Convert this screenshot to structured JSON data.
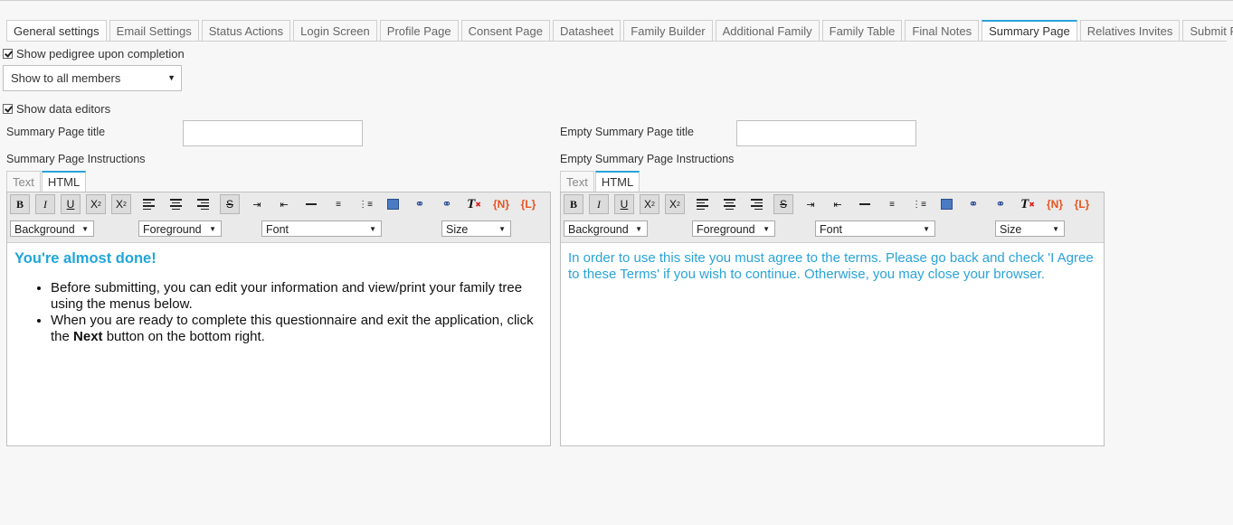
{
  "tabs": [
    {
      "label": "General settings"
    },
    {
      "label": "Email Settings"
    },
    {
      "label": "Status Actions"
    },
    {
      "label": "Login Screen"
    },
    {
      "label": "Profile Page"
    },
    {
      "label": "Consent Page"
    },
    {
      "label": "Datasheet"
    },
    {
      "label": "Family Builder"
    },
    {
      "label": "Additional Family"
    },
    {
      "label": "Family Table"
    },
    {
      "label": "Final Notes"
    },
    {
      "label": "Summary Page"
    },
    {
      "label": "Relatives Invites"
    },
    {
      "label": "Submit Page"
    }
  ],
  "active_tab": "Summary Page",
  "options": {
    "show_pedigree_label": "Show pedigree upon completion",
    "show_pedigree_checked": true,
    "pedigree_visibility": "Show to all members",
    "show_data_editors_label": "Show data editors",
    "show_data_editors_checked": true
  },
  "left": {
    "title_label": "Summary Page title",
    "title_value": "",
    "instructions_label": "Summary Page Instructions",
    "editor_tabs": [
      "Text",
      "HTML"
    ],
    "toolbar_dropdowns": {
      "background": "Background",
      "foreground": "Foreground",
      "font": "Font",
      "size": "Size"
    },
    "tokens": {
      "n": "{N}",
      "l": "{L}"
    },
    "content": {
      "heading": "You're almost done!",
      "bullet1": "Before submitting, you can edit your information and view/print your family tree using the menus below.",
      "bullet2_prefix": "When you are ready to complete this questionnaire and exit the application, click the ",
      "bullet2_bold": "Next",
      "bullet2_suffix": " button on the bottom right."
    }
  },
  "right": {
    "title_label": "Empty Summary Page title",
    "title_value": "",
    "instructions_label": "Empty Summary Page Instructions",
    "editor_tabs": [
      "Text",
      "HTML"
    ],
    "toolbar_dropdowns": {
      "background": "Background",
      "foreground": "Foreground",
      "font": "Font",
      "size": "Size"
    },
    "tokens": {
      "n": "{N}",
      "l": "{L}"
    },
    "content": {
      "paragraph": "In order to use this site you must agree to the terms. Please go back and check 'I Agree to these Terms' if you wish to continue. Otherwise, you may close your browser."
    }
  },
  "colors": {
    "accent": "#29a3d8",
    "heading": "#1fa6d9",
    "token": "#e8531f"
  }
}
